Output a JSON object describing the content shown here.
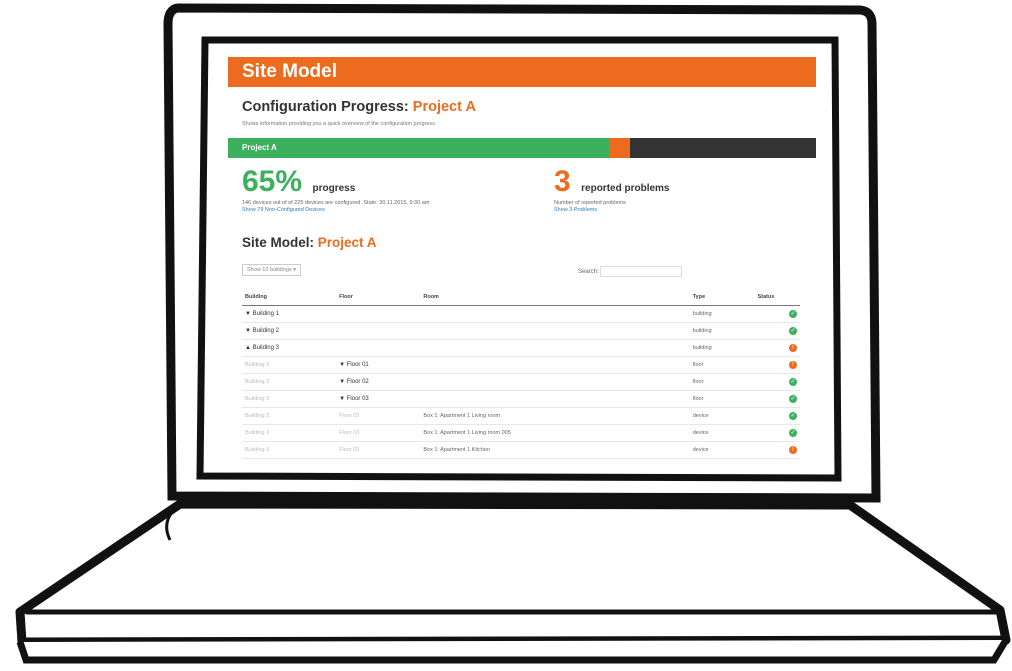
{
  "app": {
    "title": "Site Model",
    "accent_color": "#ec6b1f",
    "success_color": "#3bb05d"
  },
  "config": {
    "heading": "Configuration Progress:",
    "project": "Project A",
    "subtitle": "Shows information providing you a quick overview of the configuration progress."
  },
  "progress_bar": {
    "label": "Project A",
    "fraction": 0.65
  },
  "progress_stat": {
    "value": "65%",
    "caption": "progress",
    "detail": "146 devices out of of 225 devices are configured. State: 30.11.2015, 9:30 am",
    "link": "Show 79 Non-Configured Devices"
  },
  "problems_stat": {
    "value": "3",
    "caption": "reported problems",
    "detail": "Number of reported problems",
    "link": "Show 3 Problems"
  },
  "site_model": {
    "heading": "Site Model:",
    "project": "Project A"
  },
  "controls": {
    "show_select": "Show 10 buildings",
    "search_label": "Search:"
  },
  "table": {
    "headers": {
      "building": "Building",
      "floor": "Floor",
      "room": "Room",
      "type": "Type",
      "status": "Status"
    },
    "rows": [
      {
        "building": "Building 1",
        "floor": "",
        "room": "",
        "type": "building",
        "status": "ok"
      },
      {
        "building": "Building 2",
        "floor": "",
        "room": "",
        "type": "building",
        "status": "ok"
      },
      {
        "building": "Building 3",
        "floor": "",
        "room": "",
        "type": "building",
        "status": "problem"
      },
      {
        "building": "Building 3",
        "floor": "Floor 01",
        "room": "",
        "type": "floor",
        "status": "problem"
      },
      {
        "building": "Building 3",
        "floor": "Floor 02",
        "room": "",
        "type": "floor",
        "status": "ok"
      },
      {
        "building": "Building 3",
        "floor": "Floor 03",
        "room": "",
        "type": "floor",
        "status": "ok"
      },
      {
        "building": "Building 3",
        "floor": "Floor 03",
        "room": "Box 1: Apartment 1 Living room",
        "type": "device",
        "status": "ok"
      },
      {
        "building": "Building 3",
        "floor": "Floor 03",
        "room": "Box 1: Apartment 1 Living room 005",
        "type": "device",
        "status": "ok"
      },
      {
        "building": "Building 3",
        "floor": "Floor 03",
        "room": "Box 1: Apartment 1 Kitchen",
        "type": "device",
        "status": "problem"
      }
    ]
  }
}
